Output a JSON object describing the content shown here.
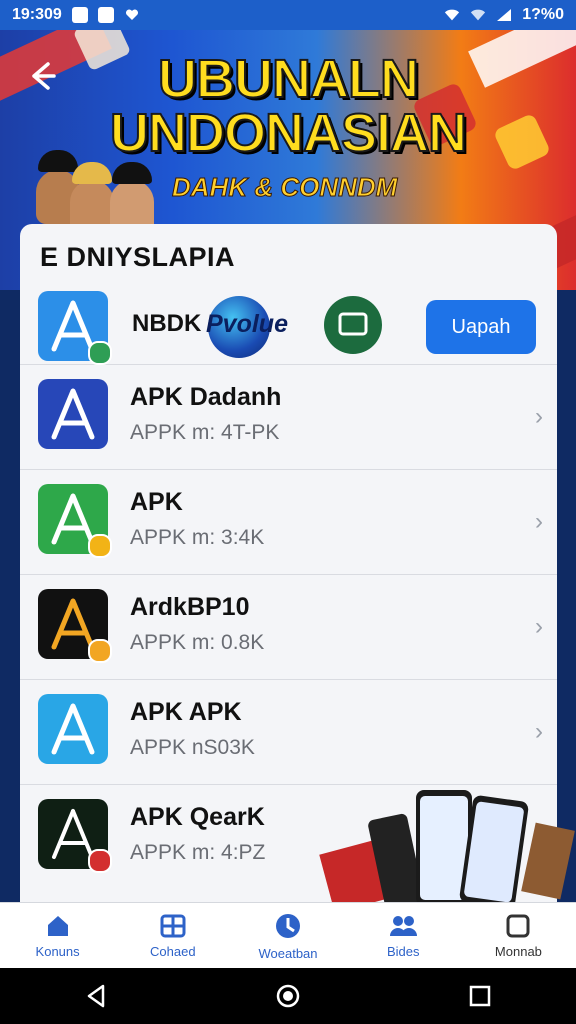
{
  "status_bar": {
    "time": "19:309",
    "battery": "1?%0"
  },
  "hero": {
    "title_line1": "UBUNALN",
    "title_line2": "UNDONASIAN",
    "subtitle": "DAHK & CONNDM"
  },
  "card": {
    "title": "E DNIYSLAPIA",
    "featured": {
      "label": "NBDK",
      "brand_text": "Pvolue",
      "button": "Uapah"
    },
    "items": [
      {
        "title": "APK Dadanh",
        "subtitle": "APPK m: 4T-PK"
      },
      {
        "title": "APK",
        "subtitle": "APPK m: 3:4K"
      },
      {
        "title": "ArdkBP10",
        "subtitle": "APPK m: 0.8K"
      },
      {
        "title": "APK APK",
        "subtitle": "APPK nS03K"
      },
      {
        "title": "APK QearK",
        "subtitle": "APPK m: 4:PZ"
      }
    ]
  },
  "bottom_nav": [
    {
      "label": "Konuns",
      "icon": "home-icon"
    },
    {
      "label": "Cohaed",
      "icon": "grid-icon"
    },
    {
      "label": "Woeatban",
      "icon": "compass-icon"
    },
    {
      "label": "Bides",
      "icon": "people-icon"
    },
    {
      "label": "Monnab",
      "icon": "square-icon"
    }
  ],
  "colors": {
    "accent": "#1e73e8",
    "status": "#1d5fc9",
    "nav_text": "#2d62c8"
  }
}
